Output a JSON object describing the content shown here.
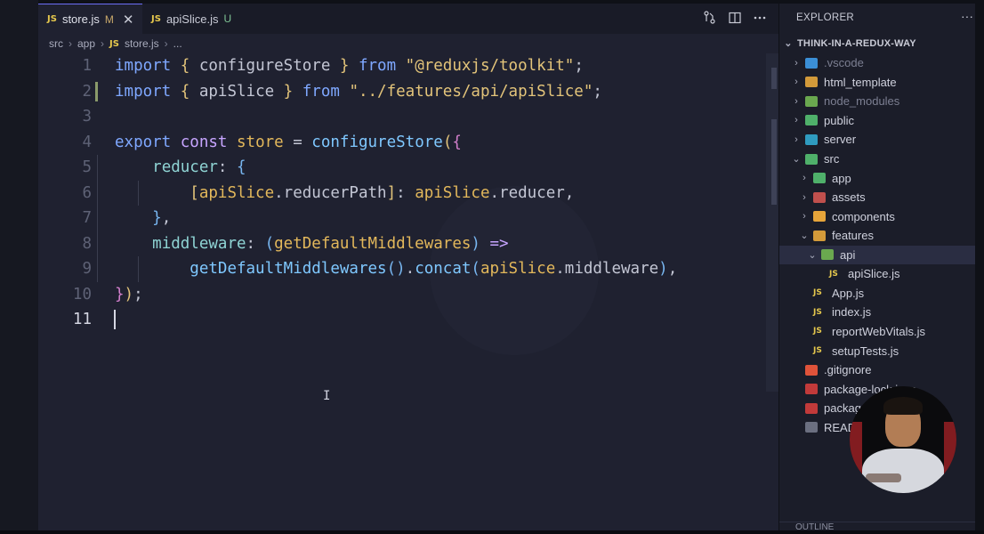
{
  "tabs": [
    {
      "badge": "JS",
      "name": "store.js",
      "status": "M",
      "close": "✕"
    },
    {
      "badge": "JS",
      "name": "apiSlice.js",
      "status": "U"
    }
  ],
  "tab_icons": [
    "source-control-icon",
    "split-editor-icon",
    "more-icon"
  ],
  "breadcrumb": {
    "p1": "src",
    "p2": "app",
    "badge": "JS",
    "p3": "store.js",
    "p4": "..."
  },
  "code": {
    "lines": [
      {
        "n": "1",
        "tokens": [
          [
            "import",
            "kw"
          ],
          [
            " ",
            ""
          ],
          [
            "{",
            "br1"
          ],
          [
            " configureStore ",
            "dimtxt"
          ],
          [
            "}",
            "br1"
          ],
          [
            " from ",
            "kw"
          ],
          [
            "\"@reduxjs/toolkit\"",
            "str"
          ],
          [
            ";",
            "dimtxt"
          ]
        ]
      },
      {
        "n": "2",
        "tokens": [
          [
            "import",
            "kw"
          ],
          [
            " ",
            ""
          ],
          [
            "{",
            "br1"
          ],
          [
            " apiSlice ",
            "dimtxt"
          ],
          [
            "}",
            "br1"
          ],
          [
            " from ",
            "kw"
          ],
          [
            "\"../features/api/apiSlice\"",
            "str"
          ],
          [
            ";",
            "dimtxt"
          ]
        ]
      },
      {
        "n": "3",
        "tokens": []
      },
      {
        "n": "4",
        "tokens": [
          [
            "export",
            "kw"
          ],
          [
            " ",
            ""
          ],
          [
            "const",
            "kw2"
          ],
          [
            " ",
            ""
          ],
          [
            "store",
            "var"
          ],
          [
            " = ",
            "dimtxt"
          ],
          [
            "configureStore",
            "fn"
          ],
          [
            "(",
            "br1"
          ],
          [
            "{",
            "br2"
          ]
        ]
      },
      {
        "n": "5",
        "tokens": [
          [
            "    ",
            ""
          ],
          [
            "reducer",
            "prop"
          ],
          [
            ": ",
            "dimtxt"
          ],
          [
            "{",
            "br3"
          ]
        ]
      },
      {
        "n": "6",
        "tokens": [
          [
            "        ",
            ""
          ],
          [
            "[",
            "br1"
          ],
          [
            "apiSlice",
            "var"
          ],
          [
            ".reducerPath",
            "dimtxt"
          ],
          [
            "]",
            "br1"
          ],
          [
            ": ",
            "dimtxt"
          ],
          [
            "apiSlice",
            "var"
          ],
          [
            ".reducer,",
            "dimtxt"
          ]
        ]
      },
      {
        "n": "7",
        "tokens": [
          [
            "    ",
            ""
          ],
          [
            "}",
            "br3"
          ],
          [
            ",",
            "dimtxt"
          ]
        ]
      },
      {
        "n": "8",
        "tokens": [
          [
            "    ",
            ""
          ],
          [
            "middleware",
            "prop"
          ],
          [
            ": ",
            "dimtxt"
          ],
          [
            "(",
            "br3"
          ],
          [
            "getDefaultMiddlewares",
            "var"
          ],
          [
            ")",
            "br3"
          ],
          [
            " =>",
            "kw2"
          ]
        ]
      },
      {
        "n": "9",
        "tokens": [
          [
            "        ",
            ""
          ],
          [
            "getDefaultMiddlewares",
            "fn"
          ],
          [
            "()",
            "br3"
          ],
          [
            ".",
            "dimtxt"
          ],
          [
            "concat",
            "fn"
          ],
          [
            "(",
            "br3"
          ],
          [
            "apiSlice",
            "var"
          ],
          [
            ".middleware",
            "dimtxt"
          ],
          [
            ")",
            "br3"
          ],
          [
            ",",
            "dimtxt"
          ]
        ]
      },
      {
        "n": "10",
        "tokens": [
          [
            "}",
            "br2"
          ],
          [
            ")",
            "br1"
          ],
          [
            ";",
            "dimtxt"
          ]
        ]
      },
      {
        "n": "11",
        "tokens": []
      }
    ],
    "current_line": "11"
  },
  "explorer": {
    "title": "EXPLORER",
    "more": "···",
    "root": "THINK-IN-A-REDUX-WAY",
    "items": [
      {
        "label": ".vscode",
        "chev": "›",
        "icon": "vscode-folder-icon",
        "color": "#3b8fd6",
        "dim": true,
        "indent": 1
      },
      {
        "label": "html_template",
        "chev": "›",
        "icon": "folder-icon",
        "color": "#d39a3a",
        "indent": 1
      },
      {
        "label": "node_modules",
        "chev": "›",
        "icon": "node-folder-icon",
        "color": "#6aa84f",
        "dim": true,
        "indent": 1
      },
      {
        "label": "public",
        "chev": "›",
        "icon": "public-folder-icon",
        "color": "#4fb06a",
        "indent": 1
      },
      {
        "label": "server",
        "chev": "›",
        "icon": "server-folder-icon",
        "color": "#2f9bbf",
        "indent": 1
      },
      {
        "label": "src",
        "chev": "⌄",
        "icon": "src-folder-icon",
        "color": "#4fb06a",
        "indent": 1
      },
      {
        "label": "app",
        "chev": "›",
        "icon": "app-folder-icon",
        "color": "#4fb06a",
        "indent": 2
      },
      {
        "label": "assets",
        "chev": "›",
        "icon": "assets-folder-icon",
        "color": "#c0504d",
        "indent": 2
      },
      {
        "label": "components",
        "chev": "›",
        "icon": "components-folder-icon",
        "color": "#e6a43a",
        "indent": 2
      },
      {
        "label": "features",
        "chev": "⌄",
        "icon": "folder-open-icon",
        "color": "#d39a3a",
        "indent": 2
      },
      {
        "label": "api",
        "chev": "⌄",
        "icon": "api-folder-icon",
        "color": "#6aa84f",
        "indent": 3,
        "selected": true
      },
      {
        "label": "apiSlice.js",
        "chev": "",
        "icon": "js-file-icon",
        "js": "JS",
        "indent": 4
      },
      {
        "label": "App.js",
        "chev": "",
        "icon": "js-file-icon",
        "js": "JS",
        "indent": 2
      },
      {
        "label": "index.js",
        "chev": "",
        "icon": "js-file-icon",
        "js": "JS",
        "indent": 2
      },
      {
        "label": "reportWebVitals.js",
        "chev": "",
        "icon": "js-file-icon",
        "js": "JS",
        "indent": 2
      },
      {
        "label": "setupTests.js",
        "chev": "",
        "icon": "js-file-icon",
        "js": "JS",
        "indent": 2
      },
      {
        "label": ".gitignore",
        "chev": "",
        "icon": "git-icon",
        "color": "#e0533a",
        "indent": 1
      },
      {
        "label": "package-lock.json",
        "chev": "",
        "icon": "npm-icon",
        "color": "#c23a3a",
        "indent": 1
      },
      {
        "label": "package.json",
        "chev": "",
        "icon": "npm-icon",
        "color": "#c23a3a",
        "indent": 1
      },
      {
        "label": "README.md",
        "chev": "",
        "icon": "markdown-icon",
        "color": "#6b6f80",
        "indent": 1
      }
    ],
    "outline": "OUTLINE"
  }
}
